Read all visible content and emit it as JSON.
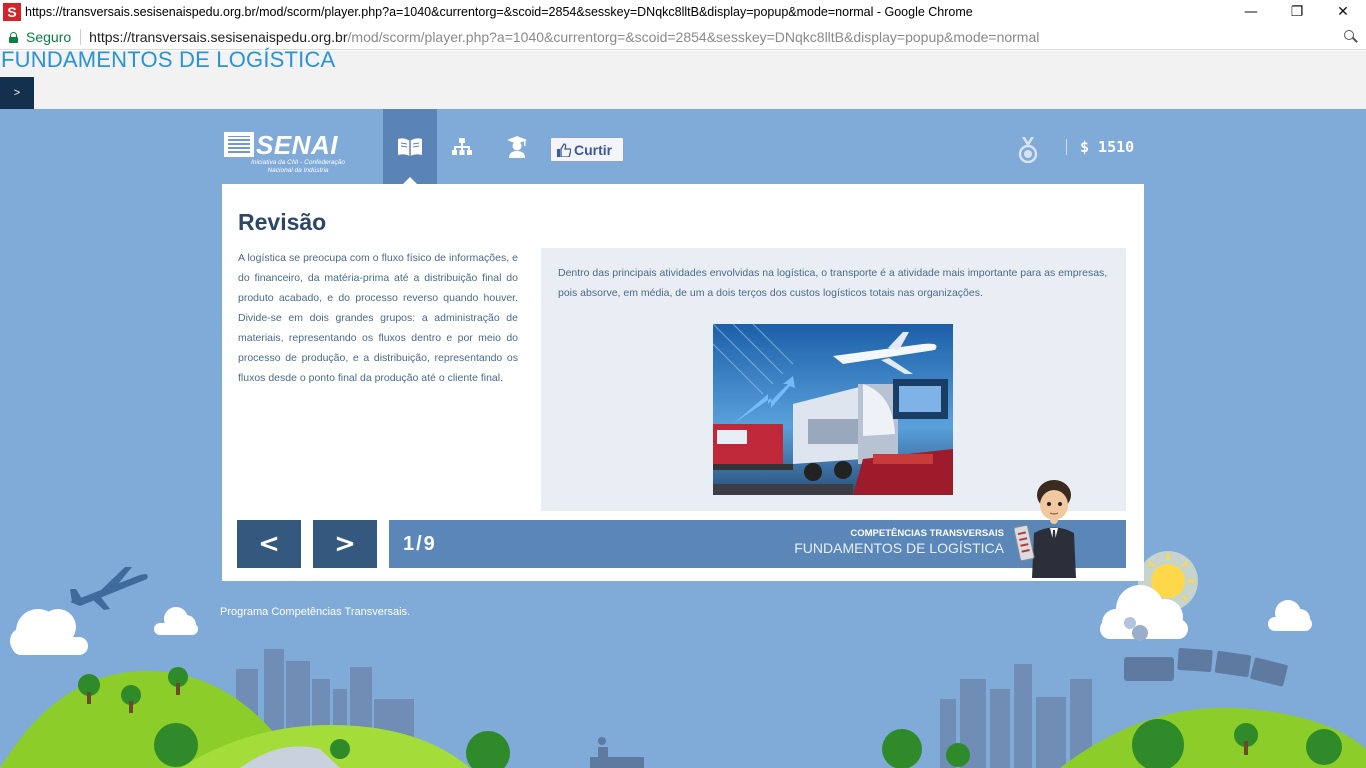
{
  "window": {
    "title": "https://transversais.sesisenaispedu.org.br/mod/scorm/player.php?a=1040&currentorg=&scoid=2854&sesskey=DNqkc8lltB&display=popup&mode=normal - Google Chrome",
    "favicon_letter": "S",
    "controls": {
      "minimize": "—",
      "restore": "❐",
      "close": "✕"
    }
  },
  "addressbar": {
    "secure_label": "Seguro",
    "url_host": "https://transversais.sesisenaispedu.org.br",
    "url_path": "/mod/scorm/player.php?a=1040&currentorg=&scoid=2854&sesskey=DNqkc8lltB&display=popup&mode=normal"
  },
  "header": {
    "title": "FUNDAMENTOS DE LOGÍSTICA",
    "toc_toggle": ">"
  },
  "topnav": {
    "logo_word": "SENAI",
    "logo_tagline": "Iniciativa da CNI - Confederação Nacional da Indústria",
    "like_label": "Curtir",
    "score": "$ 1510"
  },
  "content": {
    "heading": "Revisão",
    "body": "A logística se preocupa com o fluxo físico de informações, e do financeiro, da matéria-prima até a distribuição final do produto acabado, e do processo reverso quando houver. Divide-se em dois grandes grupos: a administração de materiais, representando os fluxos dentro e por meio do processo de produção, e a distribuição, representando os fluxos desde o ponto final da produção até o cliente final.",
    "info_text": "Dentro das principais atividades envolvidas na logística, o transporte é a atividade mais importante para as empresas, pois absorve, em média, de um a dois terços dos custos logísticos totais nas organizações."
  },
  "pager": {
    "prev_label": "<",
    "next_label": ">",
    "counter": "1/9",
    "course_small": "COMPETÊNCIAS TRANSVERSAIS",
    "course_big": "FUNDAMENTOS DE LOGÍSTICA"
  },
  "footer": {
    "note": "Programa Competências Transversais."
  },
  "colors": {
    "stage_bg": "#80aad8",
    "nav_dark": "#35587f",
    "progress": "#5b86b8",
    "heading": "#2c4669",
    "title_blue": "#2a93d5"
  }
}
